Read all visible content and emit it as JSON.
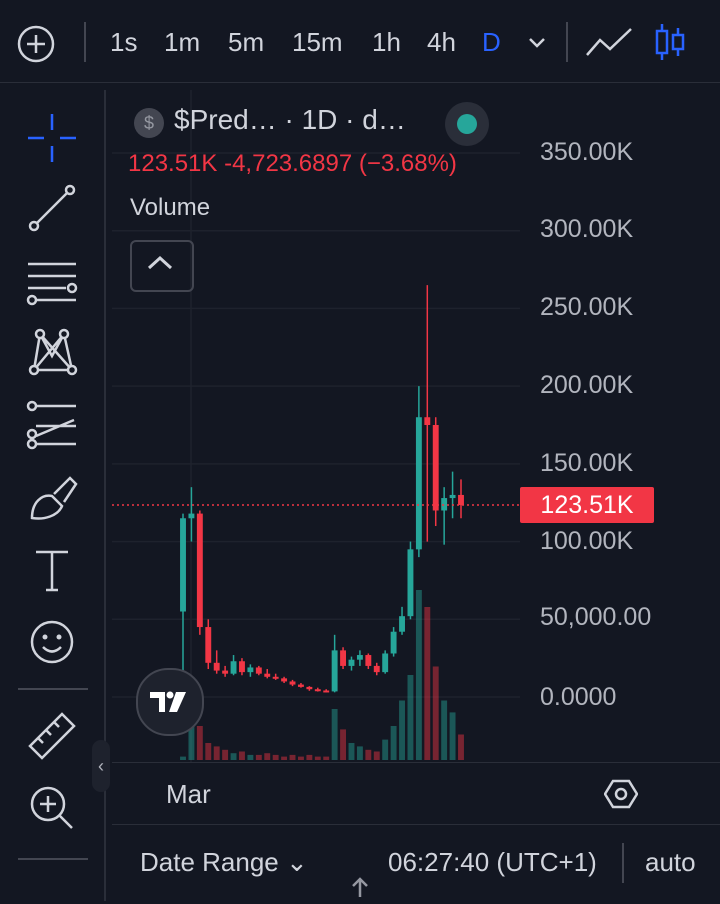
{
  "topbar": {
    "intervals": [
      "1s",
      "1m",
      "5m",
      "15m",
      "1h",
      "4h",
      "D"
    ],
    "active_interval": "D",
    "icons": [
      "add-circle-icon",
      "chevron-down-icon",
      "line-chart-icon",
      "candles-icon"
    ]
  },
  "toolbar": {
    "icons": [
      "crosshair-icon",
      "trend-line-icon",
      "fib-retracement-icon",
      "pattern-icon",
      "forecast-icon",
      "brush-icon",
      "text-icon",
      "emoji-icon",
      "ruler-icon",
      "zoom-in-icon"
    ]
  },
  "legend": {
    "symbol_icon": "$",
    "title": "$Pred… · 1D · d…",
    "ohlc": "123.51K  -4,723.6897 (−3.68%)",
    "volume_label": "Volume"
  },
  "price_axis": {
    "labels": [
      "350.00K",
      "300.00K",
      "250.00K",
      "200.00K",
      "150.00K",
      "100.00K",
      "50,000.00",
      "0.0000"
    ],
    "current_price": "123.51K"
  },
  "time_axis": {
    "label": "Mar"
  },
  "bottom_bar": {
    "date_range": "Date Range ⌄",
    "time": "06:27:40 (UTC+1)",
    "scale": "auto"
  },
  "colors": {
    "up": "#26a69a",
    "down": "#f23645",
    "accent": "#2962ff",
    "background": "#131722"
  },
  "chart_data": {
    "type": "candlestick",
    "y_axis_range": [
      0,
      350000
    ],
    "current_price": 123510,
    "candles": [
      {
        "o": 55000,
        "h": 118000,
        "l": 0,
        "c": 115000
      },
      {
        "o": 115000,
        "h": 135000,
        "l": 100000,
        "c": 118000
      },
      {
        "o": 118000,
        "h": 120000,
        "l": 40000,
        "c": 45000
      },
      {
        "o": 45000,
        "h": 50000,
        "l": 18000,
        "c": 22000
      },
      {
        "o": 22000,
        "h": 30000,
        "l": 15000,
        "c": 17000
      },
      {
        "o": 17000,
        "h": 20000,
        "l": 13000,
        "c": 15000
      },
      {
        "o": 15000,
        "h": 27000,
        "l": 14000,
        "c": 23000
      },
      {
        "o": 23000,
        "h": 25000,
        "l": 14000,
        "c": 16000
      },
      {
        "o": 16000,
        "h": 21000,
        "l": 13000,
        "c": 19000
      },
      {
        "o": 19000,
        "h": 20000,
        "l": 14000,
        "c": 15000
      },
      {
        "o": 15000,
        "h": 18000,
        "l": 12000,
        "c": 13000
      },
      {
        "o": 13000,
        "h": 15000,
        "l": 11000,
        "c": 12000
      },
      {
        "o": 12000,
        "h": 13000,
        "l": 9000,
        "c": 10000
      },
      {
        "o": 10000,
        "h": 11000,
        "l": 7000,
        "c": 8000
      },
      {
        "o": 8000,
        "h": 9000,
        "l": 6000,
        "c": 6500
      },
      {
        "o": 6500,
        "h": 7000,
        "l": 4000,
        "c": 5000
      },
      {
        "o": 5000,
        "h": 6000,
        "l": 3500,
        "c": 4200
      },
      {
        "o": 4200,
        "h": 5000,
        "l": 3000,
        "c": 3600
      },
      {
        "o": 3600,
        "h": 40000,
        "l": 3000,
        "c": 30000
      },
      {
        "o": 30000,
        "h": 32000,
        "l": 18000,
        "c": 20000
      },
      {
        "o": 20000,
        "h": 26000,
        "l": 17000,
        "c": 24000
      },
      {
        "o": 24000,
        "h": 30000,
        "l": 20000,
        "c": 27000
      },
      {
        "o": 27000,
        "h": 28000,
        "l": 18000,
        "c": 20000
      },
      {
        "o": 20000,
        "h": 22000,
        "l": 14000,
        "c": 16000
      },
      {
        "o": 16000,
        "h": 30000,
        "l": 15000,
        "c": 28000
      },
      {
        "o": 28000,
        "h": 45000,
        "l": 26000,
        "c": 42000
      },
      {
        "o": 42000,
        "h": 58000,
        "l": 40000,
        "c": 52000
      },
      {
        "o": 52000,
        "h": 100000,
        "l": 50000,
        "c": 95000
      },
      {
        "o": 95000,
        "h": 200000,
        "l": 90000,
        "c": 180000
      },
      {
        "o": 180000,
        "h": 265000,
        "l": 100000,
        "c": 175000
      },
      {
        "o": 175000,
        "h": 180000,
        "l": 110000,
        "c": 120000
      },
      {
        "o": 120000,
        "h": 135000,
        "l": 98000,
        "c": 128000
      },
      {
        "o": 128000,
        "h": 145000,
        "l": 115000,
        "c": 130000
      },
      {
        "o": 130000,
        "h": 140000,
        "l": 115000,
        "c": 123510
      }
    ],
    "volumes": [
      2,
      45,
      20,
      10,
      8,
      6,
      4,
      5,
      3,
      3,
      4,
      3,
      2,
      3,
      2,
      3,
      2,
      2,
      30,
      18,
      10,
      8,
      6,
      5,
      12,
      20,
      35,
      50,
      100,
      90,
      55,
      35,
      28,
      15
    ]
  }
}
